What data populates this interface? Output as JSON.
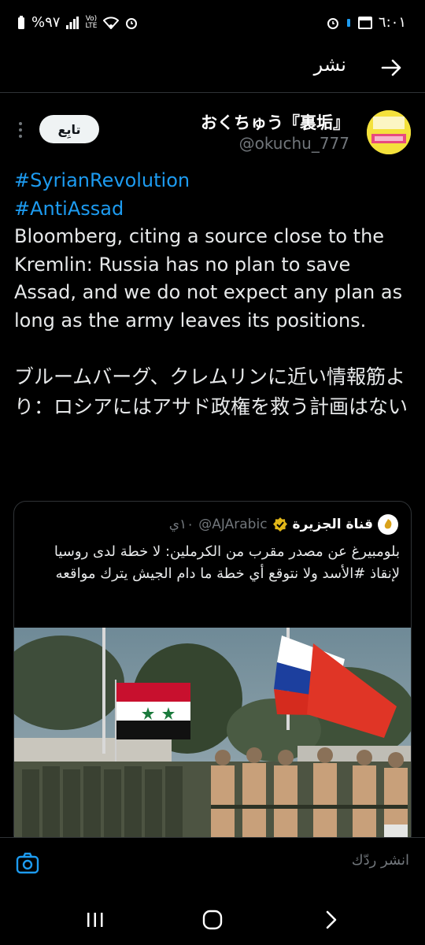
{
  "status_bar": {
    "time": "٦:٠١",
    "battery": "%٩٧",
    "network": "LTE"
  },
  "header": {
    "title": "نشر"
  },
  "tweet": {
    "author_name": "おくちゅう『裏垢』",
    "author_handle": "@okuchu_777",
    "follow_label": "تابِع",
    "hashtags": [
      "#SyrianRevolution",
      "#AntiAssad"
    ],
    "text_en": "Bloomberg, citing a source close to the Kremlin: Russia has no plan to save Assad, and we do not expect any plan as long as the army leaves its positions.",
    "text_jp": "ブルームバーグ、クレムリンに近い情報筋より：ロシアにはアサド政権を救う計画はない"
  },
  "quoted_tweet": {
    "name": "قناة الجزيرة",
    "handle": "@AJArabic",
    "time": "١٠ي",
    "text": "بلومبيرغ عن مصدر مقرب من الكرملين: لا خطة لدى روسيا لإنقاذ #الأسد ولا نتوقع أي خطة ما دام الجيش يترك مواقعه"
  },
  "reply_bar": {
    "placeholder": "انشر ردّك"
  },
  "colors": {
    "background": "#000000",
    "accent": "#1d9bf0",
    "muted": "#71767b",
    "verified": "#e2b719"
  }
}
